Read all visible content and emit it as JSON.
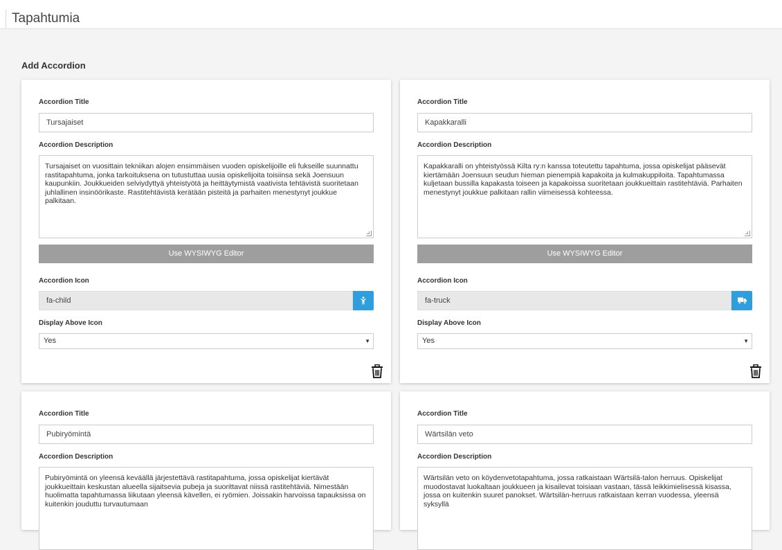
{
  "header": {
    "title": "Tapahtumia"
  },
  "section": {
    "title": "Add Accordion"
  },
  "labels": {
    "title": "Accordion Title",
    "description": "Accordion Description",
    "wysiwyg": "Use WYSIWYG Editor",
    "icon": "Accordion Icon",
    "display_above": "Display Above Icon"
  },
  "accordions": [
    {
      "title": "Tursajaiset",
      "description": "Tursajaiset on vuosittain tekniikan alojen ensimmäisen vuoden opiskelijoille eli fukseille suunnattu rastitapahtuma, jonka tarkoituksena on tutustuttaa uusia opiskelijoita toisiinsa sekä Joensuun kaupunkiin. Joukkueiden selviydyttyä yhteistyötä ja heittäytymistä vaativista tehtävistä suoritetaan juhlallinen insinöörikaste. Rastitehtävistä kerätään pisteitä ja parhaiten menestynyt joukkue palkitaan.",
      "icon": "fa-child",
      "icon_name": "child-icon",
      "display_above": "Yes"
    },
    {
      "title": "Kapakkaralli",
      "description": "Kapakkaralli on yhteistyössä Kilta ry:n kanssa toteutettu tapahtuma, jossa opiskelijat pääsevät kiertämään Joensuun seudun hieman pienempiä kapakoita ja kulmakuppiloita. Tapahtumassa kuljetaan bussilla kapakasta toiseen ja kapakoissa suoritetaan joukkueittain rastitehtäviä. Parhaiten menestynyt joukkue palkitaan rallin viimeisessä kohteessa.",
      "icon": "fa-truck",
      "icon_name": "truck-icon",
      "display_above": "Yes"
    },
    {
      "title": "Pubiryömintä",
      "description": "Pubiryömintä on yleensä keväällä järjestettävä rastitapahtuma, jossa opiskelijat kiertävät joukkueittain keskustan alueella sijaitsevia pubeja ja suorittavat niissä rastitehtäviä. Nimestään huolimatta tapahtumassa liikutaan yleensä kävellen, ei ryömien. Joissakin harvoissa tapauksissa on kuitenkin jouduttu turvautumaan"
    },
    {
      "title": "Wärtsilän veto",
      "description": "Wärtsilän veto on köydenvetotapahtuma, jossa ratkaistaan Wärtsilä-talon herruus. Opiskelijat muodostavat luokaltaan joukkueen ja kisailevat toisiaan vastaan, tässä leikkimielisessä kisassa, jossa on kuitenkin suuret panokset. Wärtsilän-herruus ratkaistaan kerran vuodessa, yleensä syksyllä"
    }
  ],
  "colors": {
    "accent": "#2e9fdc",
    "wysiwyg_bg": "#9e9e9e",
    "page_bg": "#f4f4f4"
  }
}
